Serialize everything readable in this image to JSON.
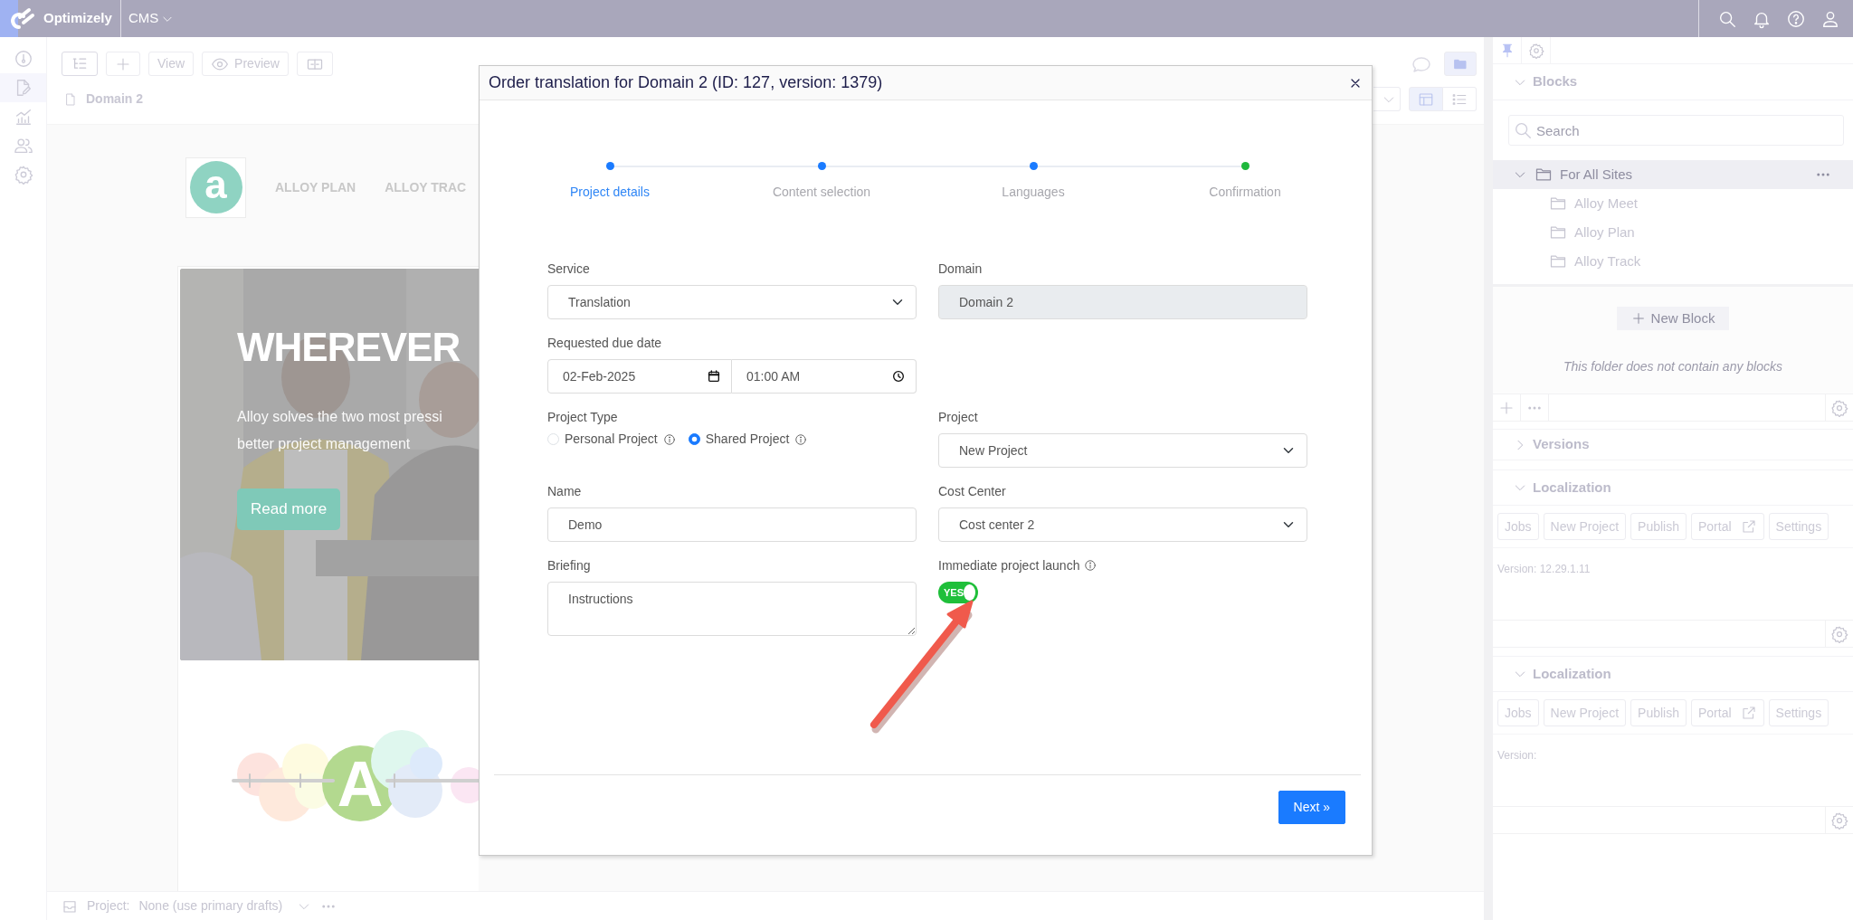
{
  "top_bar": {
    "brand": "Optimizely",
    "app_menu": "CMS"
  },
  "editor_toolbar": {
    "view_button": "View",
    "preview_button": "Preview",
    "page_title": "Domain 2"
  },
  "preview": {
    "logo_letter": "a",
    "nav_links": [
      "ALLOY PLAN",
      "ALLOY TRAC"
    ],
    "hero": {
      "kind": "picture",
      "heading": "WHEREVER",
      "lines": [
        "Alloy solves the two most pressi",
        "better project management"
      ],
      "button": "Read more"
    },
    "graphic_letter": "A"
  },
  "dialog": {
    "title": "Order translation for Domain 2 (ID: 127, version: 1379)",
    "steps": [
      {
        "label": "Project details",
        "selected": true,
        "color": "#1a7bff"
      },
      {
        "label": "Content selection",
        "selected": false,
        "color": "#1a7bff"
      },
      {
        "label": "Languages",
        "selected": false,
        "color": "#1a7bff"
      },
      {
        "label": "Confirmation",
        "selected": false,
        "color": "#1fb83c"
      }
    ],
    "service": {
      "label": "Service",
      "value": "Translation"
    },
    "domain": {
      "label": "Domain",
      "value": "Domain 2",
      "disabled": true
    },
    "due_date": {
      "label": "Requested due date",
      "date": "02-Feb-2025",
      "time": "01:00 AM"
    },
    "project_type": {
      "label": "Project Type",
      "options": [
        {
          "label": "Personal Project",
          "selected": false
        },
        {
          "label": "Shared Project",
          "selected": true
        }
      ]
    },
    "project": {
      "label": "Project",
      "value": "New Project"
    },
    "name": {
      "label": "Name",
      "value": "Demo"
    },
    "cost_center": {
      "label": "Cost Center",
      "value": "Cost center 2"
    },
    "briefing": {
      "label": "Briefing",
      "value": "Instructions"
    },
    "immediate_launch": {
      "label": "Immediate project launch",
      "on": true,
      "state_text": "YES"
    },
    "next_button": "Next »"
  },
  "right_panel": {
    "blocks": {
      "title": "Blocks",
      "expanded": true,
      "search_placeholder": "Search",
      "tree": [
        {
          "label": "For All Sites",
          "expanded": true,
          "selected": true,
          "children": [
            {
              "label": "Alloy Meet",
              "selected": false
            },
            {
              "label": "Alloy Plan",
              "selected": false
            },
            {
              "label": "Alloy Track",
              "selected": false
            }
          ]
        }
      ],
      "new_block": "New Block",
      "empty_note": "This folder does not contain any blocks"
    },
    "versions": {
      "title": "Versions",
      "expanded": false
    },
    "localization_panels": [
      {
        "title": "Localization",
        "expanded": true,
        "buttons": [
          {
            "label": "Jobs",
            "kind": "plain"
          },
          {
            "label": "New Project",
            "kind": "plain"
          },
          {
            "label": "Publish",
            "kind": "plain"
          },
          {
            "label": "Portal",
            "kind": "external"
          },
          {
            "label": "Settings",
            "kind": "plain"
          }
        ],
        "version": "Version: 12.29.1.11"
      },
      {
        "title": "Localization",
        "expanded": true,
        "buttons": [
          {
            "label": "Jobs",
            "kind": "plain"
          },
          {
            "label": "New Project",
            "kind": "plain"
          },
          {
            "label": "Publish",
            "kind": "plain"
          },
          {
            "label": "Portal",
            "kind": "external"
          },
          {
            "label": "Settings",
            "kind": "plain"
          }
        ],
        "version": "Version:"
      }
    ]
  },
  "status_bar": {
    "label": "Project:",
    "value": "None (use primary drafts)"
  }
}
